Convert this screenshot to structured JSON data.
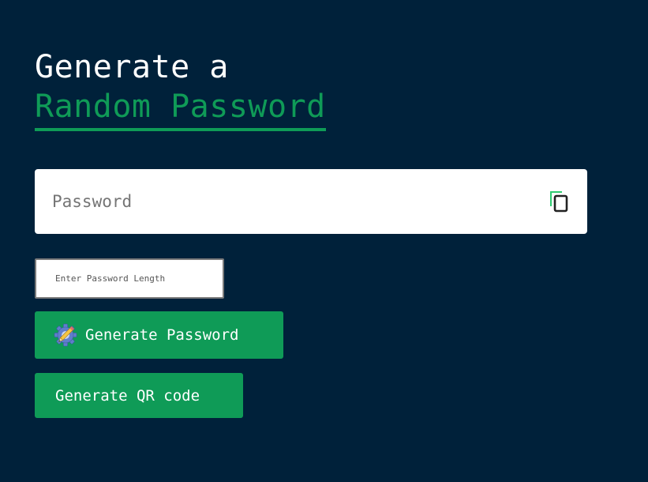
{
  "header": {
    "title_line1": "Generate a",
    "title_line2": "Random Password"
  },
  "password_field": {
    "placeholder": "Password",
    "value": "",
    "copy_icon": "copy-icon"
  },
  "length_field": {
    "placeholder": "Enter Password Length",
    "value": ""
  },
  "buttons": {
    "generate_password_label": "Generate Password",
    "generate_password_icon": "gear-pencil-icon",
    "generate_qr_label": "Generate QR code"
  },
  "colors": {
    "background": "#00213a",
    "accent": "#0f9b57",
    "text": "#ffffff",
    "field_bg": "#ffffff"
  }
}
